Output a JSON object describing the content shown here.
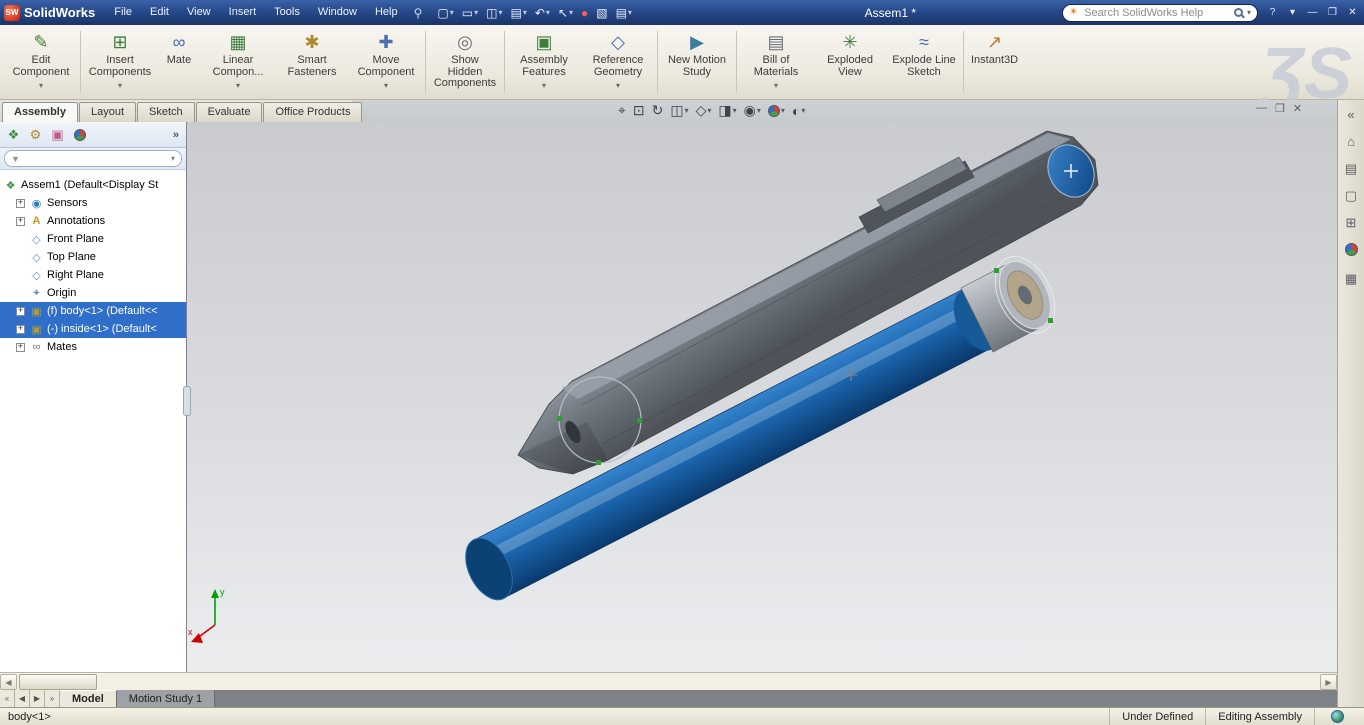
{
  "titlebar": {
    "logo_text": "SolidWorks",
    "logo_badge": "SW",
    "menus": [
      "File",
      "Edit",
      "View",
      "Insert",
      "Tools",
      "Window",
      "Help"
    ],
    "doc_title": "Assem1 *",
    "search_placeholder": "Search SolidWorks Help",
    "qat": [
      {
        "name": "new-document",
        "glyph": "▢",
        "dropdown": true
      },
      {
        "name": "open",
        "glyph": "▭",
        "dropdown": true
      },
      {
        "name": "save",
        "glyph": "◫",
        "dropdown": true
      },
      {
        "name": "print",
        "glyph": "▤",
        "dropdown": true
      },
      {
        "name": "undo",
        "glyph": "↶",
        "dropdown": true
      },
      {
        "name": "select",
        "glyph": "↖",
        "dropdown": true
      },
      {
        "name": "record-macro",
        "glyph": "●",
        "dropdown": false
      },
      {
        "name": "screen-capture",
        "glyph": "▧",
        "dropdown": false
      },
      {
        "name": "options",
        "glyph": "▤",
        "dropdown": true
      }
    ],
    "window_controls": {
      "help": "?",
      "dropdown": "▾",
      "minimize": "—",
      "restore": "❐",
      "close": "✕"
    }
  },
  "ribbon": {
    "watermark": "ƷS",
    "buttons": [
      {
        "label": "Edit Component",
        "glyph": "✎",
        "dropdown": true
      },
      {
        "label": "Insert Components",
        "glyph": "⊞",
        "dropdown": true
      },
      {
        "label": "Mate",
        "glyph": "∞",
        "dropdown": false
      },
      {
        "label": "Linear Compon...",
        "glyph": "▦",
        "dropdown": true
      },
      {
        "label": "Smart Fasteners",
        "glyph": "✱",
        "dropdown": false
      },
      {
        "label": "Move Component",
        "glyph": "✚",
        "dropdown": true
      },
      {
        "label": "Show Hidden Components",
        "glyph": "◎",
        "dropdown": false
      },
      {
        "label": "Assembly Features",
        "glyph": "▣",
        "dropdown": true
      },
      {
        "label": "Reference Geometry",
        "glyph": "◇",
        "dropdown": true
      },
      {
        "label": "New Motion Study",
        "glyph": "▶",
        "dropdown": false
      },
      {
        "label": "Bill of Materials",
        "glyph": "▤",
        "dropdown": true
      },
      {
        "label": "Exploded View",
        "glyph": "✳",
        "dropdown": false
      },
      {
        "label": "Explode Line Sketch",
        "glyph": "≈",
        "dropdown": false
      },
      {
        "label": "Instant3D",
        "glyph": "↗",
        "dropdown": false
      }
    ]
  },
  "command_tabs": [
    {
      "label": "Assembly"
    },
    {
      "label": "Layout"
    },
    {
      "label": "Sketch"
    },
    {
      "label": "Evaluate"
    },
    {
      "label": "Office Products"
    }
  ],
  "hud": [
    {
      "name": "zoom-to-fit",
      "glyph": "⌖"
    },
    {
      "name": "zoom-to-area",
      "glyph": "⊡"
    },
    {
      "name": "previous-view",
      "glyph": "↻"
    },
    {
      "name": "section-view",
      "glyph": "◫"
    },
    {
      "name": "view-orientation",
      "glyph": "◇"
    },
    {
      "name": "display-style",
      "glyph": "◨"
    },
    {
      "name": "hide-show-items",
      "glyph": "◉"
    },
    {
      "name": "edit-appearance",
      "glyph": ""
    },
    {
      "name": "apply-scene",
      "glyph": "◐"
    }
  ],
  "panel": {
    "tabs": [
      {
        "name": "featuremanager-tree",
        "glyph": "❖"
      },
      {
        "name": "propertymanager",
        "glyph": "⚙"
      },
      {
        "name": "configurationmanager",
        "glyph": "▣"
      },
      {
        "name": "displaymanager",
        "glyph": ""
      }
    ],
    "overflow": "»",
    "filter_glyph": "▼",
    "tree": [
      {
        "label": "Assem1 (Default<Display St",
        "glyph": "❖"
      },
      {
        "label": "Sensors",
        "glyph": "◉"
      },
      {
        "label": "Annotations",
        "glyph": "A"
      },
      {
        "label": "Front Plane",
        "glyph": "◇"
      },
      {
        "label": "Top Plane",
        "glyph": "◇"
      },
      {
        "label": "Right Plane",
        "glyph": "◇"
      },
      {
        "label": "Origin",
        "glyph": "⌖"
      },
      {
        "label": "(f) body<1> (Default<<",
        "glyph": "▣"
      },
      {
        "label": "(-) inside<1> (Default<",
        "glyph": "▣"
      },
      {
        "label": "Mates",
        "glyph": "∞"
      }
    ]
  },
  "taskpane": [
    {
      "name": "collapse-taskpane",
      "glyph": "«"
    },
    {
      "name": "solidworks-resources",
      "glyph": "⌂"
    },
    {
      "name": "design-library",
      "glyph": "▤"
    },
    {
      "name": "file-explorer",
      "glyph": "▢"
    },
    {
      "name": "view-palette",
      "glyph": "⊞"
    },
    {
      "name": "appearances-scenes",
      "glyph": ""
    },
    {
      "name": "custom-properties",
      "glyph": "▦"
    }
  ],
  "viewport": {
    "triad_x": "x",
    "triad_y": "y"
  },
  "scroll": {
    "left_arrow": "◀",
    "right_arrow": "▶"
  },
  "model_nav": [
    "«",
    "◀",
    "▶",
    "»"
  ],
  "model_tabs": [
    {
      "label": "Model"
    },
    {
      "label": "Motion Study 1"
    }
  ],
  "statusbar": {
    "selection": "body<1>",
    "state": "Under Defined",
    "mode": "Editing Assembly"
  }
}
